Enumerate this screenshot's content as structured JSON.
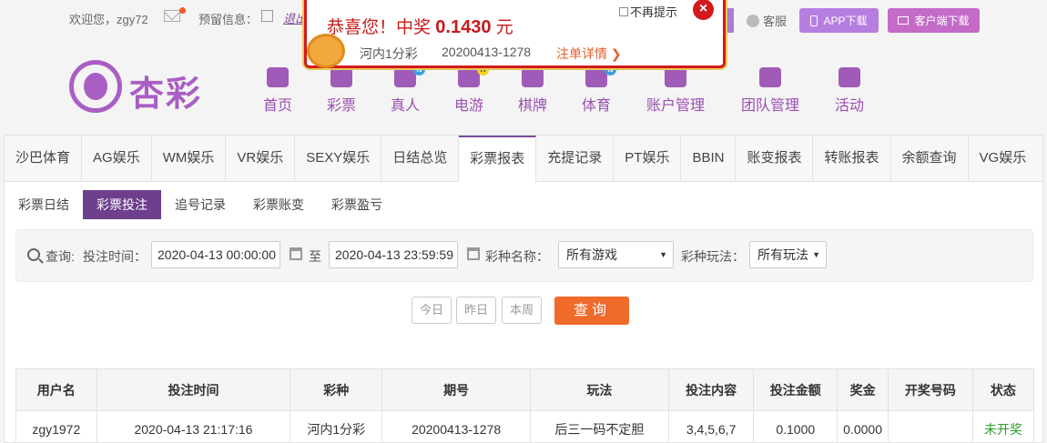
{
  "topbar": {
    "welcome": "欢迎您，zgy72",
    "warning_label": "预留信息：",
    "logout": "退出",
    "service": "客服",
    "app_download": "APP下载",
    "client_download": "客户端下载"
  },
  "logo": {
    "text": "杏彩"
  },
  "nav": [
    {
      "label": "首页",
      "icon": "home-icon",
      "badge": ""
    },
    {
      "label": "彩票",
      "icon": "lottery-icon",
      "badge": ""
    },
    {
      "label": "真人",
      "icon": "live-icon",
      "badge": "N"
    },
    {
      "label": "电游",
      "icon": "gamepad-icon",
      "badge": "H"
    },
    {
      "label": "棋牌",
      "icon": "cards-icon",
      "badge": ""
    },
    {
      "label": "体育",
      "icon": "trophy-icon",
      "badge": "N"
    },
    {
      "label": "账户管理",
      "icon": "account-icon",
      "badge": ""
    },
    {
      "label": "团队管理",
      "icon": "team-icon",
      "badge": ""
    },
    {
      "label": "活动",
      "icon": "gift-icon",
      "badge": ""
    }
  ],
  "tabs": [
    "沙巴体育",
    "AG娱乐",
    "WM娱乐",
    "VR娱乐",
    "SEXY娱乐",
    "日结总览",
    "彩票报表",
    "充提记录",
    "PT娱乐",
    "BBIN",
    "账变报表",
    "转账报表",
    "余额查询",
    "VG娱乐"
  ],
  "active_tab": "彩票报表",
  "subtabs": [
    "彩票日结",
    "彩票投注",
    "追号记录",
    "彩票账变",
    "彩票盈亏"
  ],
  "active_subtab": "彩票投注",
  "filter": {
    "query_label": "查询:",
    "time_label": "投注时间：",
    "start": "2020-04-13 00:00:00",
    "to": "至",
    "end": "2020-04-13 23:59:59",
    "game_label": "彩种名称：",
    "game_value": "所有游戏",
    "play_label": "彩种玩法：",
    "play_value": "所有玩法"
  },
  "quick": {
    "today": "今日",
    "yesterday": "昨日",
    "week": "本周",
    "query": "查询"
  },
  "table": {
    "headers": [
      "用户名",
      "投注时间",
      "彩种",
      "期号",
      "玩法",
      "投注内容",
      "投注金额",
      "奖金",
      "开奖号码",
      "状态"
    ],
    "rows": [
      [
        "zgy1972",
        "2020-04-13 21:17:16",
        "河内1分彩",
        "20200413-1278",
        "后三一码不定胆",
        "3,4,5,6,7",
        "0.1000",
        "0.0000",
        "",
        "未开奖"
      ]
    ]
  },
  "popup": {
    "title_prefix": "恭喜您！中奖",
    "amount": "0.1430",
    "unit": "元",
    "game": "河内1分彩",
    "issue": "20200413-1278",
    "detail": "注单详情 ❯",
    "no_remind": "不再提示",
    "close": "×"
  }
}
